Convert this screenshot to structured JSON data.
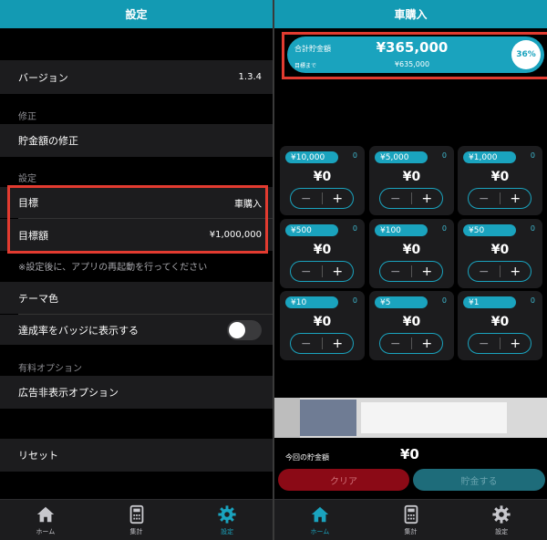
{
  "left": {
    "title": "設定",
    "version_label": "バージョン",
    "version_value": "1.3.4",
    "section_edit": "修正",
    "edit_savings": "貯金額の修正",
    "section_settings": "設定",
    "goal_label": "目標",
    "goal_value": "車購入",
    "goal_amount_label": "目標額",
    "goal_amount_value": "¥1,000,000",
    "restart_note": "※設定後に、アプリの再起動を行ってください",
    "theme_color": "テーマ色",
    "badge_label": "達成率をバッジに表示する",
    "badge_toggle_on": false,
    "section_paid": "有料オプション",
    "ad_free": "広告非表示オプション",
    "reset": "リセット"
  },
  "right": {
    "title": "車購入",
    "goal_card": {
      "total_label": "合計貯金額",
      "until_label": "目標まで",
      "total": "¥365,000",
      "remaining": "¥635,000",
      "percent": "36%"
    },
    "denominations": [
      {
        "label": "¥10,000",
        "count": "0",
        "amount": "¥0"
      },
      {
        "label": "¥5,000",
        "count": "0",
        "amount": "¥0"
      },
      {
        "label": "¥1,000",
        "count": "0",
        "amount": "¥0"
      },
      {
        "label": "¥500",
        "count": "0",
        "amount": "¥0"
      },
      {
        "label": "¥100",
        "count": "0",
        "amount": "¥0"
      },
      {
        "label": "¥50",
        "count": "0",
        "amount": "¥0"
      },
      {
        "label": "¥10",
        "count": "0",
        "amount": "¥0"
      },
      {
        "label": "¥5",
        "count": "0",
        "amount": "¥0"
      },
      {
        "label": "¥1",
        "count": "0",
        "amount": "¥0"
      }
    ],
    "stepper_minus": "−",
    "stepper_plus": "+",
    "today_label": "今回の貯金額",
    "today_amount": "¥0",
    "clear_button": "クリア",
    "save_button": "貯金する"
  },
  "tabs": [
    {
      "label": "ホーム",
      "icon": "home-icon"
    },
    {
      "label": "集計",
      "icon": "calculator-icon"
    },
    {
      "label": "設定",
      "icon": "gear-icon"
    }
  ],
  "colors": {
    "accent": "#1aa3be",
    "header": "#139ab3",
    "highlight": "#e23b30",
    "clear": "#8b0a16",
    "save": "#1e6c7a"
  }
}
